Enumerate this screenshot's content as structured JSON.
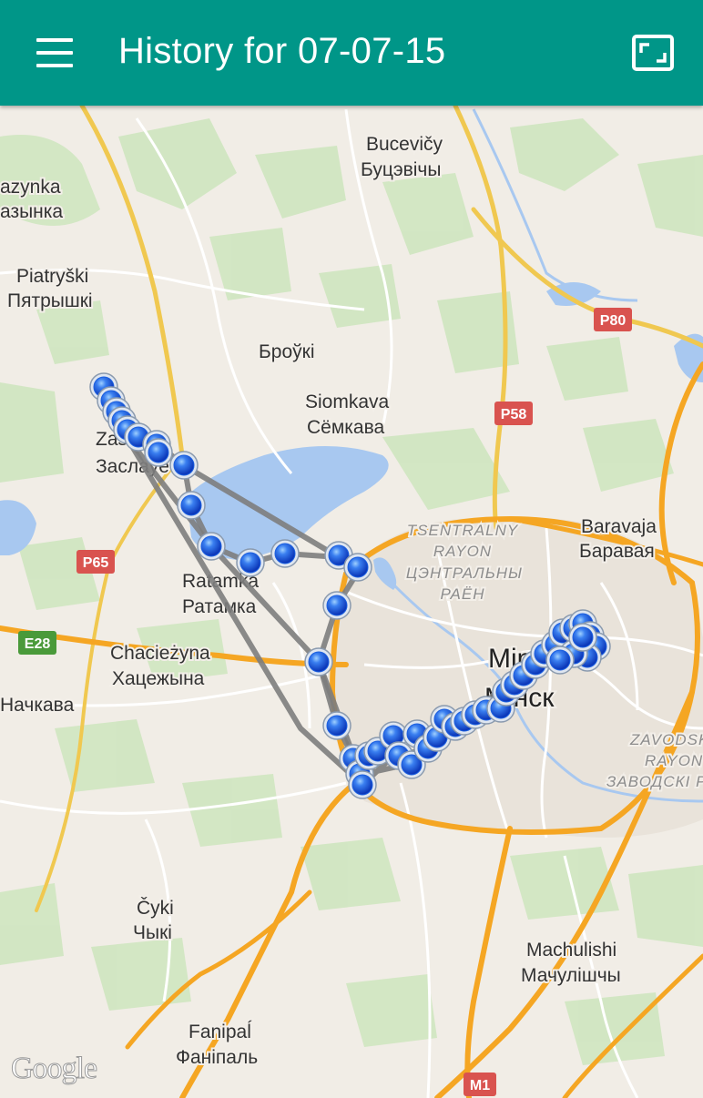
{
  "app_bar": {
    "title": "History for 07-07-15",
    "menu_icon": "hamburger-menu-icon",
    "fullscreen_icon": "fullscreen-icon",
    "background_color": "#009688"
  },
  "map": {
    "attribution": "Google",
    "place_labels": [
      {
        "id": "bucevicy-latin",
        "text": "Bucevičy"
      },
      {
        "id": "bucevicy-cyr",
        "text": "Буцэвічы"
      },
      {
        "id": "lazynka-latin",
        "text": "azynka"
      },
      {
        "id": "lazynka-cyr",
        "text": "азынка"
      },
      {
        "id": "piatryski-latin",
        "text": "Piatryški"
      },
      {
        "id": "piatryski-cyr",
        "text": "Пятрышкі"
      },
      {
        "id": "brouki",
        "text": "Броўкі"
      },
      {
        "id": "siomkava-latin",
        "text": "Siomkava"
      },
      {
        "id": "siomkava-cyr",
        "text": "Сёмкава"
      },
      {
        "id": "zaslauje-latin",
        "text": "Zaslaŭje"
      },
      {
        "id": "zaslauje-cyr",
        "text": "Заслаўе"
      },
      {
        "id": "ratamka-latin",
        "text": "Ratamka"
      },
      {
        "id": "ratamka-cyr",
        "text": "Ратамка"
      },
      {
        "id": "chaciezyna-latin",
        "text": "Chacieżyna"
      },
      {
        "id": "chaciezyna-cyr",
        "text": "Хацежына"
      },
      {
        "id": "nachkava",
        "text": "Начкава"
      },
      {
        "id": "baravaja-latin",
        "text": "Baravaja"
      },
      {
        "id": "baravaja-cyr",
        "text": "Баравая"
      },
      {
        "id": "minsk-latin",
        "text": "Minsk"
      },
      {
        "id": "minsk-cyr",
        "text": "Мінск"
      },
      {
        "id": "cyki-latin",
        "text": "Čyki"
      },
      {
        "id": "cyki-cyr",
        "text": "Чыкі"
      },
      {
        "id": "machulishi-latin",
        "text": "Machulishi"
      },
      {
        "id": "machulishi-cyr",
        "text": "Мачулішчы"
      },
      {
        "id": "fanipal-latin",
        "text": "Fanipaĺ"
      },
      {
        "id": "fanipal-cyr",
        "text": "Фаніпаль"
      }
    ],
    "district_labels": [
      {
        "id": "tsentralny-1",
        "text": "TSENTRALNY"
      },
      {
        "id": "tsentralny-2",
        "text": "RAYON"
      },
      {
        "id": "tsentralny-3",
        "text": "ЦЭНТРАЛЬНЫ"
      },
      {
        "id": "tsentralny-4",
        "text": "РАЁН"
      },
      {
        "id": "zavodskoy-1",
        "text": "ZAVODSK"
      },
      {
        "id": "zavodskoy-2",
        "text": "RAYON"
      },
      {
        "id": "zavodskoy-3",
        "text": "ЗАВОДСКІ Р"
      }
    ],
    "road_shields": [
      {
        "id": "r80",
        "text": "P80",
        "color": "#d9534f"
      },
      {
        "id": "r58",
        "text": "P58",
        "color": "#d9534f"
      },
      {
        "id": "r65",
        "text": "P65",
        "color": "#d9534f"
      },
      {
        "id": "e28",
        "text": "E28",
        "color": "#4a9a3a"
      },
      {
        "id": "m1",
        "text": "M1",
        "color": "#d9534f"
      }
    ],
    "track": {
      "marker_icon": "location-marker-icon",
      "marker_color": "#1a5fe0",
      "line_color": "#7d7d7d"
    }
  }
}
